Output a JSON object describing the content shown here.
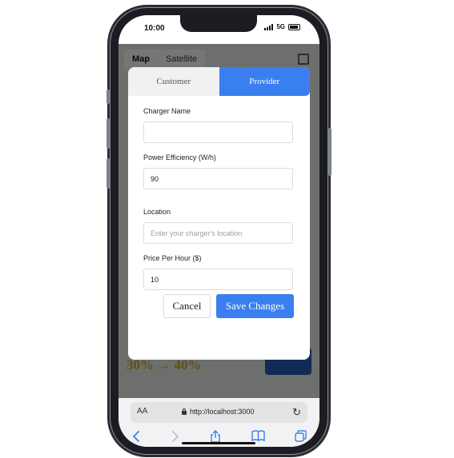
{
  "status_bar": {
    "time": "10:00",
    "network": "5G"
  },
  "map": {
    "tabs": [
      "Map",
      "Satellite"
    ],
    "active_tab": "Map",
    "promo_text": "30% → 40%"
  },
  "modal": {
    "tabs": {
      "customer": "Customer",
      "provider": "Provider"
    },
    "active_tab": "Provider",
    "fields": {
      "charger_name": {
        "label": "Charger Name",
        "value": ""
      },
      "power_efficiency": {
        "label": "Power Efficiency (W/h)",
        "value": "90"
      },
      "location": {
        "label": "Location",
        "value": "",
        "placeholder": "Enter your charger's location"
      },
      "price_per_hour": {
        "label": "Price Per Hour ($)",
        "value": "10"
      }
    },
    "buttons": {
      "cancel": "Cancel",
      "save": "Save Changes"
    },
    "colors": {
      "accent": "#3a7ff0"
    }
  },
  "browser": {
    "text_size_label": "AA",
    "url": "http://localhost:3000",
    "icons": [
      "back-icon",
      "forward-icon",
      "share-icon",
      "bookmarks-icon",
      "tabs-icon"
    ]
  }
}
